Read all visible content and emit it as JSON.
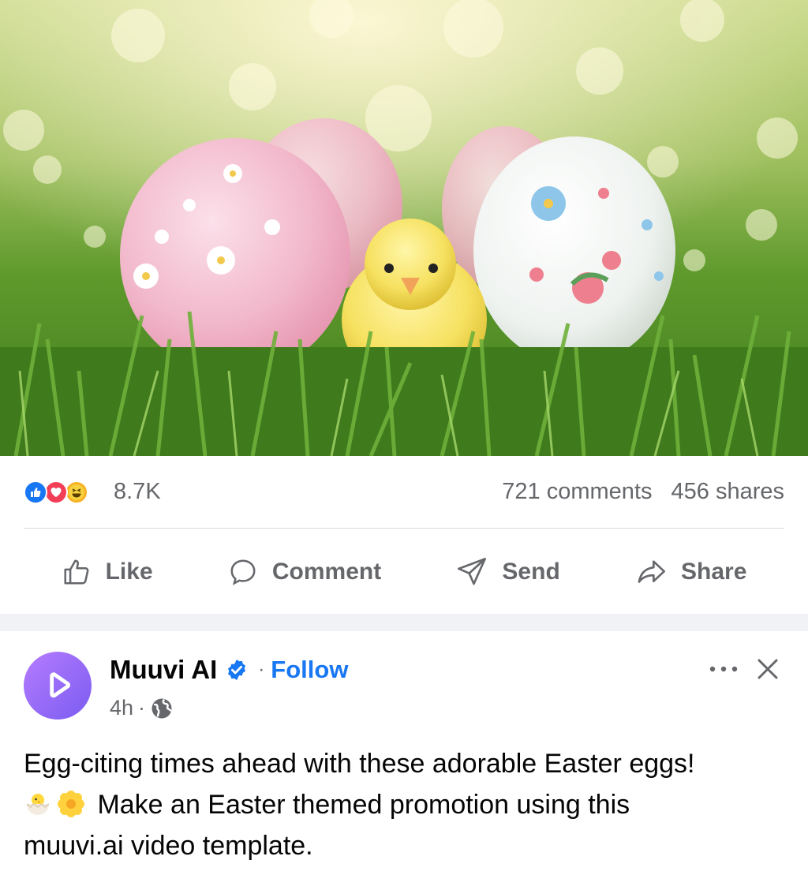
{
  "post": {
    "author": "Muuvi AI",
    "follow_label": "Follow",
    "separator": "·",
    "time": "4h",
    "body_line1": "Egg-citing times ahead with these adorable Easter eggs!",
    "body_line2": "Make an Easter themed promotion using this",
    "body_line3": "muuvi.ai video template.",
    "emojis": [
      "hatching-chick-emoji",
      "blossom-emoji"
    ]
  },
  "stats": {
    "reactions_count": "8.7K",
    "reaction_types": [
      "like",
      "love",
      "haha"
    ],
    "comments": "721 comments",
    "shares": "456 shares"
  },
  "actions": {
    "like": "Like",
    "comment": "Comment",
    "send": "Send",
    "share": "Share"
  },
  "colors": {
    "brand_blue": "#1877f2",
    "text_secondary": "#65676b",
    "love_red": "#f33e58",
    "haha_yellow": "#f7b125",
    "avatar_purple": "#8b63f5"
  },
  "photo": {
    "subject": "Easter eggs with yellow chick in grass"
  }
}
